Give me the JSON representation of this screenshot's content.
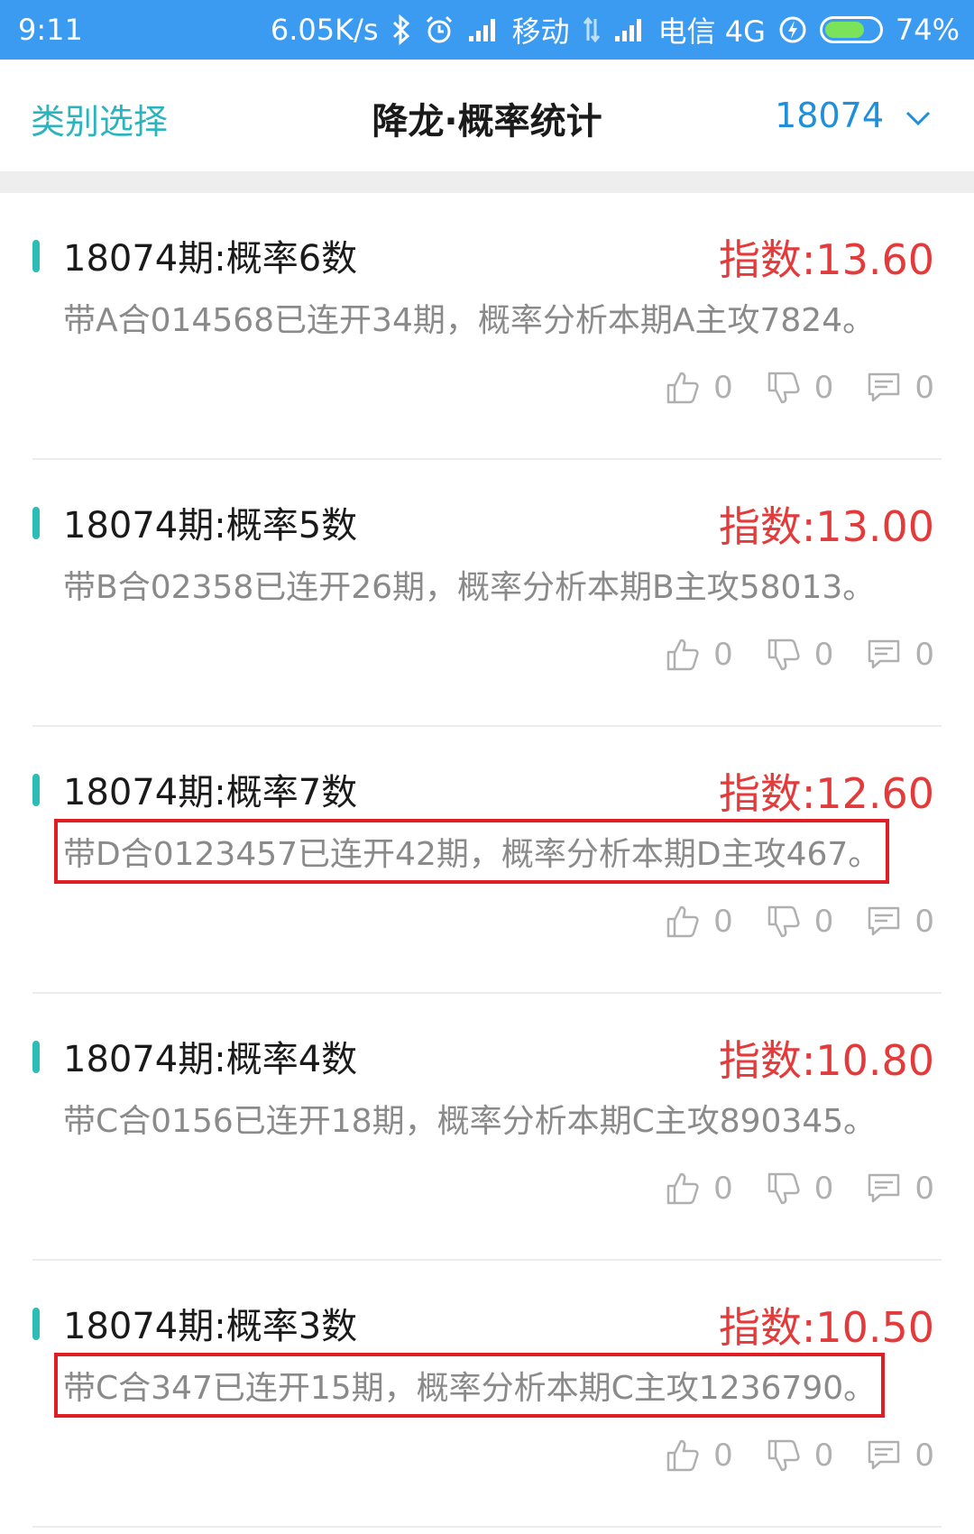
{
  "status_bar": {
    "time": "9:11",
    "speed": "6.05K/s",
    "carrier1": "移动",
    "carrier2": "电信 4G",
    "battery": "74%",
    "battery_level": 0.74,
    "icons": [
      "bluetooth-icon",
      "alarm-icon",
      "signal-icon",
      "data-arrows-icon",
      "signal-icon",
      "charging-icon",
      "battery-icon"
    ]
  },
  "header": {
    "left_label": "类别选择",
    "title": "降龙·概率统计",
    "period": "18074",
    "dropdown_icon": "chevron-down-icon"
  },
  "colors": {
    "status_bar": "#3a9bf0",
    "accent_teal": "#2bb4be",
    "period_blue": "#1e8fd8",
    "index_red": "#e33b3b",
    "highlight_red": "#e01c25"
  },
  "items": [
    {
      "title": "18074期:概率6数",
      "index": "指数:13.60",
      "desc": "带A合014568已连开34期，概率分析本期A主攻7824。",
      "likes": "0",
      "dislikes": "0",
      "comments": "0",
      "highlighted": false
    },
    {
      "title": "18074期:概率5数",
      "index": "指数:13.00",
      "desc": "带B合02358已连开26期，概率分析本期B主攻58013。",
      "likes": "0",
      "dislikes": "0",
      "comments": "0",
      "highlighted": false
    },
    {
      "title": "18074期:概率7数",
      "index": "指数:12.60",
      "desc": "带D合0123457已连开42期，概率分析本期D主攻467。",
      "likes": "0",
      "dislikes": "0",
      "comments": "0",
      "highlighted": true
    },
    {
      "title": "18074期:概率4数",
      "index": "指数:10.80",
      "desc": "带C合0156已连开18期，概率分析本期C主攻890345。",
      "likes": "0",
      "dislikes": "0",
      "comments": "0",
      "highlighted": false
    },
    {
      "title": "18074期:概率3数",
      "index": "指数:10.50",
      "desc": "带C合347已连开15期，概率分析本期C主攻1236790。",
      "likes": "0",
      "dislikes": "0",
      "comments": "0",
      "highlighted": true
    }
  ]
}
